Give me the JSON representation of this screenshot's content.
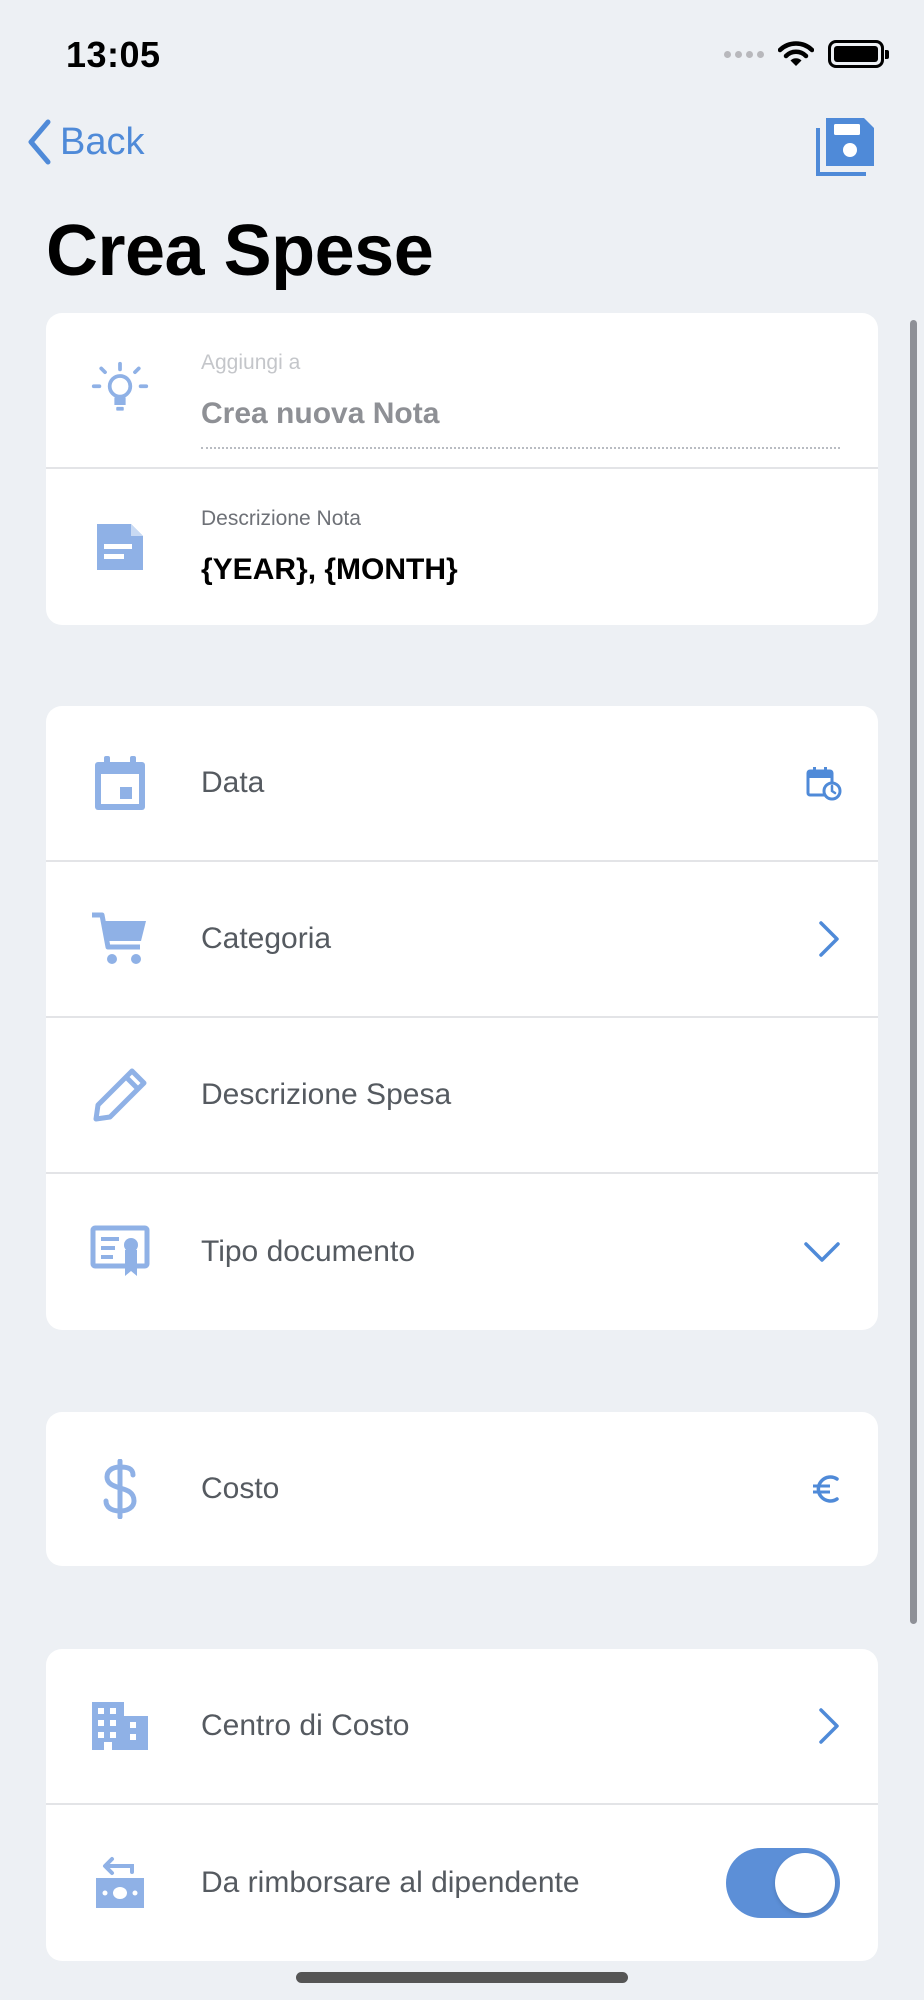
{
  "status_bar": {
    "time": "13:05"
  },
  "nav": {
    "back_label": "Back"
  },
  "page_title": "Crea Spese",
  "note_card": {
    "add_to_caption": "Aggiungi a",
    "add_to_value": "Crea nuova Nota",
    "description_caption": "Descrizione Nota",
    "description_value": "{YEAR}, {MONTH}"
  },
  "details_card": {
    "date_label": "Data",
    "category_label": "Categoria",
    "expense_description_label": "Descrizione Spesa",
    "document_type_label": "Tipo documento"
  },
  "cost_card": {
    "cost_label": "Costo"
  },
  "center_card": {
    "cost_center_label": "Centro di Costo",
    "reimburse_label": "Da rimborsare al dipendente",
    "reimburse_enabled": true
  },
  "colors": {
    "accent": "#4f8ad8",
    "icon": "#8fb1e6",
    "background": "#edf0f4",
    "toggle_on": "#5c8fd7"
  },
  "icons": {
    "add_to": "lightbulb-icon",
    "note_description": "note-icon",
    "date": "calendar-icon",
    "date_trail": "calendar-clock-icon",
    "category": "cart-icon",
    "category_trail": "chevron-right-icon",
    "expense_description": "pencil-icon",
    "document_type": "certificate-icon",
    "document_type_trail": "chevron-down-icon",
    "cost": "dollar-icon",
    "cost_trail": "euro-icon",
    "cost_center": "building-icon",
    "cost_center_trail": "chevron-right-icon",
    "reimburse": "money-return-icon",
    "save": "floppy-disk-icon",
    "back": "chevron-left-icon"
  }
}
